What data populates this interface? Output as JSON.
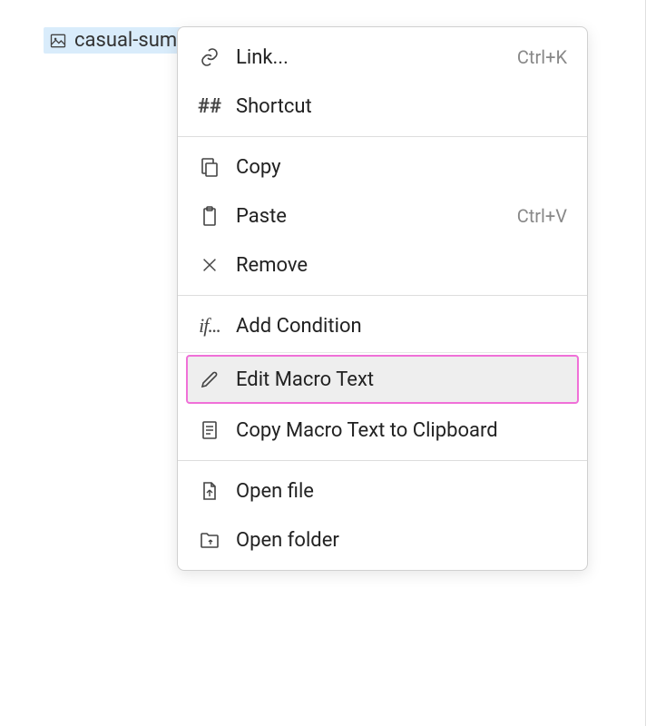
{
  "file": {
    "name": "casual-summer-dress.png"
  },
  "menu": {
    "link": {
      "label": "Link...",
      "shortcut": "Ctrl+K"
    },
    "shortcut": {
      "label": "Shortcut"
    },
    "copy": {
      "label": "Copy"
    },
    "paste": {
      "label": "Paste",
      "shortcut": "Ctrl+V"
    },
    "remove": {
      "label": "Remove"
    },
    "addCondition": {
      "label": "Add Condition"
    },
    "editMacro": {
      "label": "Edit Macro Text"
    },
    "copyMacro": {
      "label": "Copy Macro Text to Clipboard"
    },
    "openFile": {
      "label": "Open file"
    },
    "openFolder": {
      "label": "Open folder"
    }
  }
}
